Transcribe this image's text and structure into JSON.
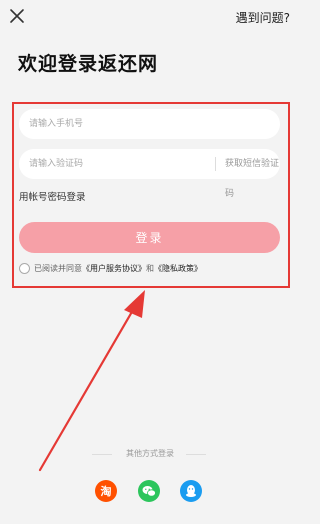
{
  "header": {
    "help_label": "遇到问题?"
  },
  "page_title": "欢迎登录返还网",
  "form": {
    "phone_placeholder": "请输入手机号",
    "code_placeholder": "请输入验证码",
    "get_code_label": "获取短信验证码",
    "password_login_label": "用帐号密码登录",
    "login_label": "登录"
  },
  "agreement": {
    "prefix": "已阅读并同意",
    "user_agreement": "《用户服务协议》",
    "and": "和",
    "privacy_policy": "《隐私政策》"
  },
  "other_login": {
    "label": "其他方式登录",
    "taobao_glyph": "淘"
  },
  "colors": {
    "accent": "#f6a0a7",
    "highlight": "#e53935",
    "taobao": "#ff5000",
    "wechat": "#2cc55c",
    "qq": "#1a9cf0"
  },
  "icons": [
    "close-icon",
    "taobao-icon",
    "wechat-icon",
    "qq-icon"
  ]
}
